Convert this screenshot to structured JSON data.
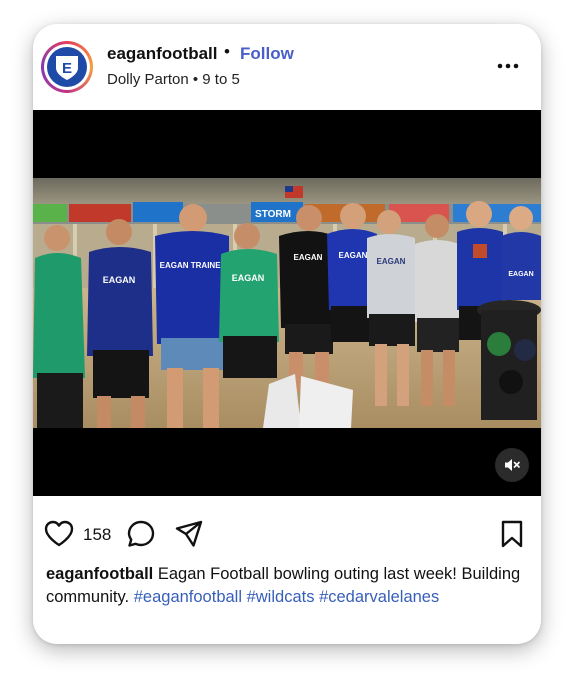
{
  "post": {
    "username": "eaganfootball",
    "separator": "•",
    "follow_label": "Follow",
    "audio": "Dolly Parton • 9 to 5",
    "like_count": "158",
    "caption_text": "Eagan Football bowling outing last week! Building community.",
    "hashtags": [
      "#eaganfootball",
      "#wildcats",
      "#cedarvalelanes"
    ]
  },
  "avatar": {
    "letter": "E"
  },
  "photo": {
    "shirts": [
      "EAGAN",
      "EAGAN",
      "EAGAN TRAINER",
      "EAGAN",
      "EAGAN",
      "EAGAN",
      "EAGAN",
      "EAGAN"
    ],
    "banners": [
      "STORM",
      "STORM"
    ]
  },
  "icons": {
    "more": "more-horizontal-icon",
    "like": "heart-icon",
    "comment": "comment-icon",
    "share": "send-icon",
    "save": "bookmark-icon",
    "mute": "muted-speaker-icon"
  },
  "colors": {
    "follow": "#4a5ec9",
    "hashtag": "#375fb9",
    "navy_shirt": "#1e2f8a",
    "green_shirt": "#1f9a6a"
  }
}
